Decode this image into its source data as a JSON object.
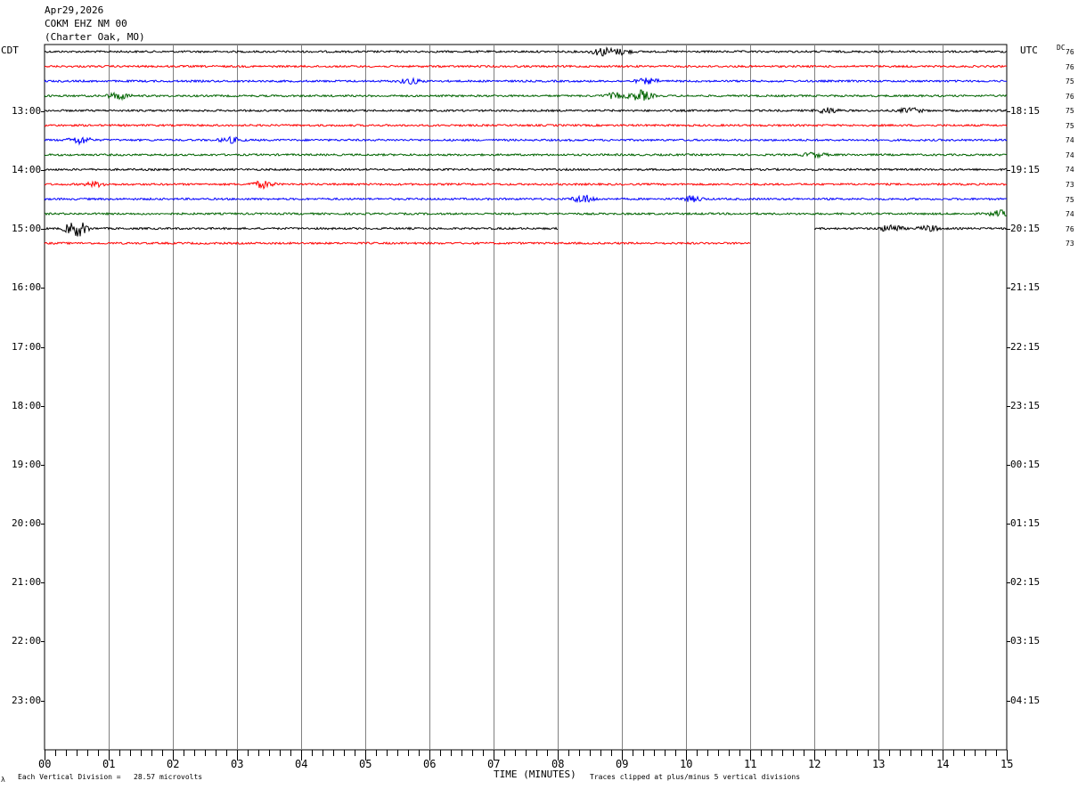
{
  "header": {
    "date": "Apr29,2026",
    "station": "COKM EHZ NM 00",
    "location": "(Charter Oak, MO)"
  },
  "left_tz": "CDT",
  "right_tz": "UTC",
  "dc_label": "DC",
  "footer": {
    "division_note": "Each Vertical Division =   28.57 microvolts",
    "clip_note": "Traces clipped at plus/minus 5 vertical divisions",
    "corner_mark": "λ"
  },
  "chart_data": {
    "type": "line",
    "title": "",
    "xlabel": "TIME (MINUTES)",
    "ylabel": "",
    "xlim": [
      0,
      15
    ],
    "x_ticks": [
      "00",
      "01",
      "02",
      "03",
      "04",
      "05",
      "06",
      "07",
      "08",
      "09",
      "10",
      "11",
      "12",
      "13",
      "14",
      "15"
    ],
    "left_hour_labels": [
      "13:00",
      "14:00",
      "15:00",
      "16:00",
      "17:00",
      "18:00",
      "19:00",
      "20:00",
      "21:00",
      "22:00",
      "23:00"
    ],
    "right_hour_labels": [
      "18:15",
      "19:15",
      "20:15",
      "21:15",
      "22:15",
      "23:15",
      "00:15",
      "01:15",
      "02:15",
      "03:15",
      "04:15"
    ],
    "traces_per_hour": 4,
    "trace_colors": [
      "#000000",
      "#ff0000",
      "#0000ff",
      "#006400"
    ],
    "series": [
      {
        "dc": "76",
        "segments": [
          [
            0,
            15
          ]
        ],
        "bursts": [
          [
            8.7,
            2.2
          ],
          [
            9.0,
            1.4
          ]
        ]
      },
      {
        "dc": "76",
        "segments": [
          [
            0,
            15
          ]
        ],
        "bursts": []
      },
      {
        "dc": "75",
        "segments": [
          [
            0,
            15
          ]
        ],
        "bursts": [
          [
            5.7,
            1.4
          ],
          [
            9.4,
            1.4
          ]
        ]
      },
      {
        "dc": "76",
        "segments": [
          [
            0,
            15
          ]
        ],
        "bursts": [
          [
            1.15,
            1.8
          ],
          [
            9.3,
            2.8
          ],
          [
            8.9,
            1.5
          ]
        ]
      },
      {
        "dc": "75",
        "segments": [
          [
            0,
            15
          ]
        ],
        "bursts": [
          [
            12.2,
            1.5
          ],
          [
            13.5,
            1.4
          ]
        ]
      },
      {
        "dc": "75",
        "segments": [
          [
            0,
            15
          ]
        ],
        "bursts": []
      },
      {
        "dc": "74",
        "segments": [
          [
            0,
            15
          ]
        ],
        "bursts": [
          [
            0.55,
            2.0
          ],
          [
            2.9,
            1.4
          ]
        ]
      },
      {
        "dc": "74",
        "segments": [
          [
            0,
            15
          ]
        ],
        "bursts": [
          [
            12.0,
            1.3
          ]
        ]
      },
      {
        "dc": "74",
        "segments": [
          [
            0,
            15
          ]
        ],
        "bursts": []
      },
      {
        "dc": "73",
        "segments": [
          [
            0,
            15
          ]
        ],
        "bursts": [
          [
            3.4,
            1.8
          ],
          [
            0.8,
            1.2
          ]
        ]
      },
      {
        "dc": "75",
        "segments": [
          [
            0,
            15
          ]
        ],
        "bursts": [
          [
            8.4,
            2.2
          ],
          [
            10.1,
            1.4
          ]
        ]
      },
      {
        "dc": "74",
        "segments": [
          [
            0,
            15
          ]
        ],
        "bursts": [
          [
            14.9,
            1.6
          ]
        ]
      },
      {
        "dc": "76",
        "segments": [
          [
            0,
            8.0
          ],
          [
            12.0,
            15
          ]
        ],
        "bursts": [
          [
            0.5,
            4.5
          ],
          [
            13.2,
            2.0
          ],
          [
            13.8,
            1.5
          ]
        ]
      },
      {
        "dc": "73",
        "segments": [
          [
            0,
            11.0
          ]
        ],
        "bursts": []
      }
    ]
  }
}
